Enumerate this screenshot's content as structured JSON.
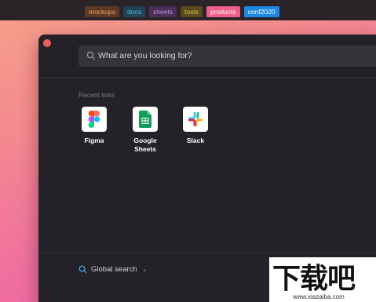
{
  "tags": [
    "mockups",
    "docs",
    "sheets",
    "tools",
    "products",
    "conf2020"
  ],
  "search": {
    "placeholder": "What are you looking for?"
  },
  "recent": {
    "heading": "Recent links",
    "items": [
      {
        "label": "Figma",
        "icon": "figma-icon"
      },
      {
        "label": "Google Sheets",
        "icon": "google-sheets-icon"
      },
      {
        "label": "Slack",
        "icon": "slack-icon"
      }
    ]
  },
  "footer": {
    "global_search": "Global search",
    "chevron": "›"
  },
  "watermark": {
    "text": "下载吧",
    "url": "www.xiazaiba.com"
  },
  "colors": {
    "close_dot": "#ec5f5f",
    "panel": "#242228",
    "search_bg": "#36343a",
    "products_tag": "#ef5e8a",
    "conf_tag": "#1e88e5"
  }
}
